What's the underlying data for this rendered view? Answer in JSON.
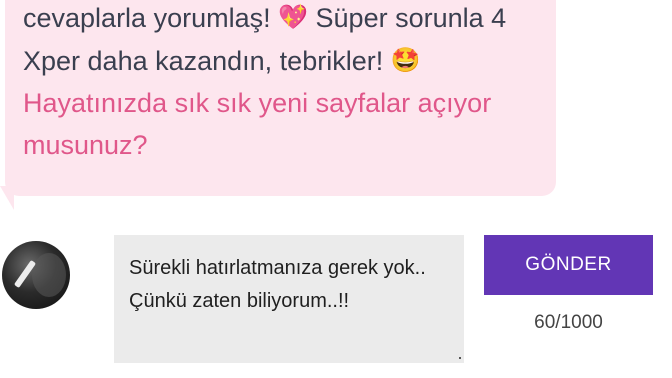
{
  "message": {
    "line1_text": "cevaplarla yorumlaş!",
    "line1_emoji": "💖",
    "line1_tail": "Süper sorunla 4",
    "line2_text": "Xper daha kazandın, tebrikler!",
    "line2_emoji": "🤩",
    "question_line1": "Hayatınızda sık sık yeni sayfalar açıyor",
    "question_line2": "musunuz?"
  },
  "composer": {
    "avatar_icon": "user-avatar-icon",
    "comment_value": "Sürekli hatırlatmanıza gerek yok.. Çünkü zaten biliyorum..!!",
    "send_label": "GÖNDER",
    "counter": "60/1000"
  },
  "colors": {
    "bubble_bg": "#fde6ee",
    "question_text": "#e0578a",
    "send_button_bg": "#6236b5",
    "input_bg": "#ebebeb"
  }
}
